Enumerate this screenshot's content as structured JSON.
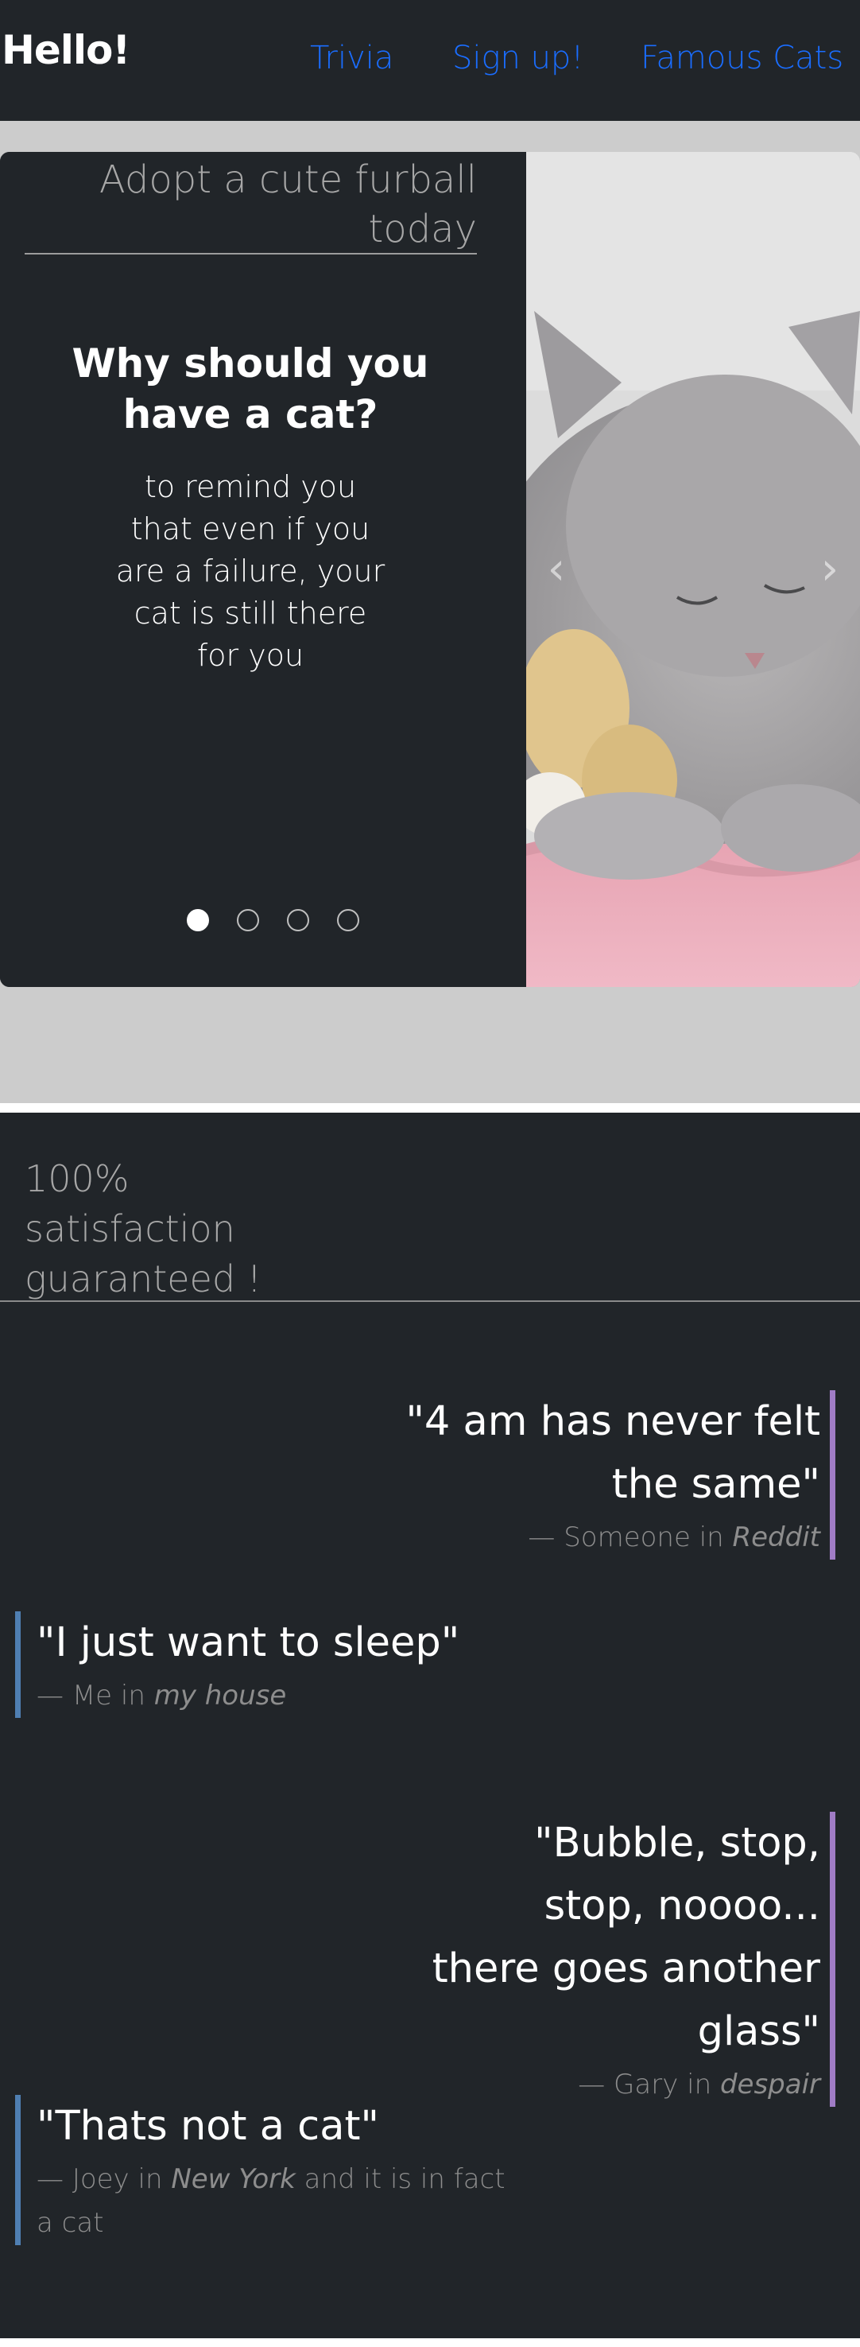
{
  "navbar": {
    "brand": "Hello!",
    "links": [
      "Trivia",
      "Sign up!",
      "Famous Cats"
    ],
    "link_color": "#1a6dff",
    "background": "#212529"
  },
  "carousel": {
    "lead": "Adopt a cute furball today",
    "title": "Why should you have a cat?",
    "body": "to remind you that even if you are a failure, your cat is still there for you",
    "indicator_count": 4,
    "active_indicator": 0,
    "prev_icon": "chevron-left-icon",
    "next_icon": "chevron-right-icon",
    "image": "sleeping-grey-kitten-with-toy"
  },
  "satisfaction": {
    "heading": "100% satisfaction guaranteed !"
  },
  "testimonials": [
    {
      "quote": "\"4 am has never felt the same\"",
      "author": "Someone",
      "source": "Reddit",
      "suffix": "",
      "align": "right"
    },
    {
      "quote": "\"I just want to sleep\"",
      "author": "Me",
      "source": "my house",
      "suffix": "",
      "align": "left"
    },
    {
      "quote": "\"Bubble, stop, stop, noooo... there goes another glass\"",
      "author": "Gary",
      "source": "despair",
      "suffix": "",
      "align": "right"
    },
    {
      "quote": "\"Thats not a cat\"",
      "author": "Joey",
      "source": "New York",
      "suffix": " and it is in fact a cat",
      "align": "left"
    }
  ],
  "colors": {
    "dark": "#212529",
    "gray_bg": "#cccccc",
    "right_quote_border": "#a07cc5",
    "left_quote_border": "#4f7fb2"
  }
}
